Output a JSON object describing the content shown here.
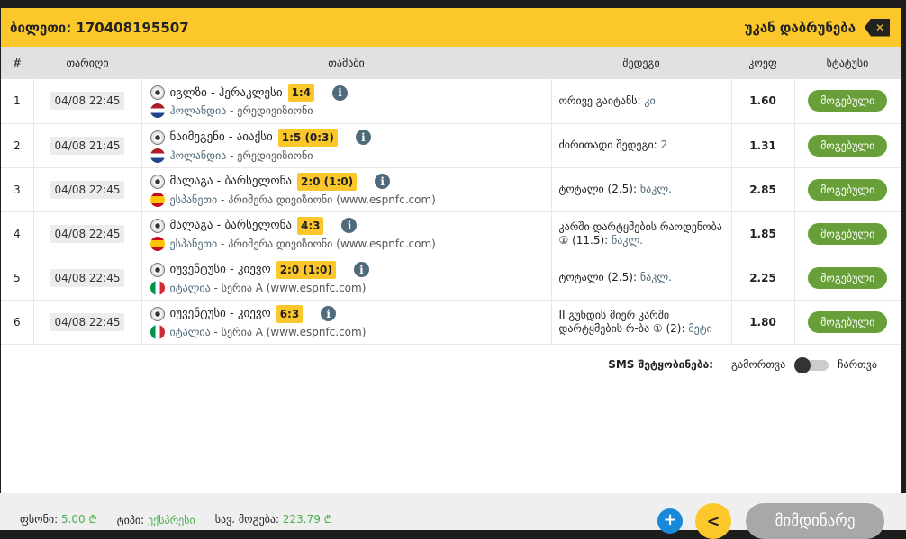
{
  "header": {
    "ticket_label": "ბილეთი: 170408195507",
    "back_label": "უკან დაბრუნება",
    "close_icon": "close-icon"
  },
  "columns": [
    "#",
    "თარიღი",
    "თამაში",
    "შედეგი",
    "კოეფ",
    "სტატუსი"
  ],
  "rows": [
    {
      "n": "1",
      "date": "04/08 22:45",
      "teams": "იგლზი - ჰერაკლესი",
      "score": "1:4",
      "country": "ჰოლანდია",
      "flag": "nl",
      "league": " - ერედივიზიონი",
      "bet": "ორივე გაიტანს: ",
      "bet_value": "კი",
      "odds": "1.60",
      "status": "მოგებული"
    },
    {
      "n": "2",
      "date": "04/08 21:45",
      "teams": "ნაიმეგენი - აიაქსი",
      "score": "1:5 (0:3)",
      "country": "ჰოლანდია",
      "flag": "nl",
      "league": " - ერედივიზიონი",
      "bet": "ძირითადი შედეგი: ",
      "bet_value": "2",
      "odds": "1.31",
      "status": "მოგებული"
    },
    {
      "n": "3",
      "date": "04/08 22:45",
      "teams": "მალაგა - ბარსელონა",
      "score": "2:0 (1:0)",
      "country": "ესპანეთი",
      "flag": "es",
      "league": " - პრიმერა დივიზიონი (www.espnfc.com)",
      "bet": "ტოტალი (2.5): ",
      "bet_value": "ნაკლ.",
      "odds": "2.85",
      "status": "მოგებული"
    },
    {
      "n": "4",
      "date": "04/08 22:45",
      "teams": "მალაგა - ბარსელონა",
      "score": "4:3",
      "country": "ესპანეთი",
      "flag": "es",
      "league": " - პრიმერა დივიზიონი (www.espnfc.com)",
      "bet": "კარში დარტყმების რაოდენობა ① (11.5): ",
      "bet_value": "ნაკლ.",
      "odds": "1.85",
      "status": "მოგებული"
    },
    {
      "n": "5",
      "date": "04/08 22:45",
      "teams": "იუვენტუსი - კიევო",
      "score": "2:0 (1:0)",
      "country": "იტალია",
      "flag": "it",
      "league": " - სერია A (www.espnfc.com)",
      "bet": "ტოტალი (2.5): ",
      "bet_value": "ნაკლ.",
      "odds": "2.25",
      "status": "მოგებული"
    },
    {
      "n": "6",
      "date": "04/08 22:45",
      "teams": "იუვენტუსი - კიევო",
      "score": "6:3",
      "country": "იტალია",
      "flag": "it",
      "league": " - სერია A (www.espnfc.com)",
      "bet": "II გუნდის მიერ კარში დარტყმების რ-ბა ① (2): ",
      "bet_value": "მეტი",
      "odds": "1.80",
      "status": "მოგებული"
    }
  ],
  "sms": {
    "label": "SMS შეტყობინება:",
    "off": "გამორთვა",
    "on": "ჩართვა",
    "enabled": false
  },
  "footer": {
    "stake_label": "ფსონი:",
    "stake": "5.00 ₾",
    "type_label": "ტიპი:",
    "type": "ექსპრესი",
    "win_label": "სავ. მოგება:",
    "win": "223.79 ₾",
    "plus": "+",
    "share": "<",
    "current": "მიმდინარე"
  },
  "colors": {
    "accent": "#fcc72a",
    "won": "#689f38",
    "link": "#4f6a7a",
    "green_text": "#4caf50"
  }
}
